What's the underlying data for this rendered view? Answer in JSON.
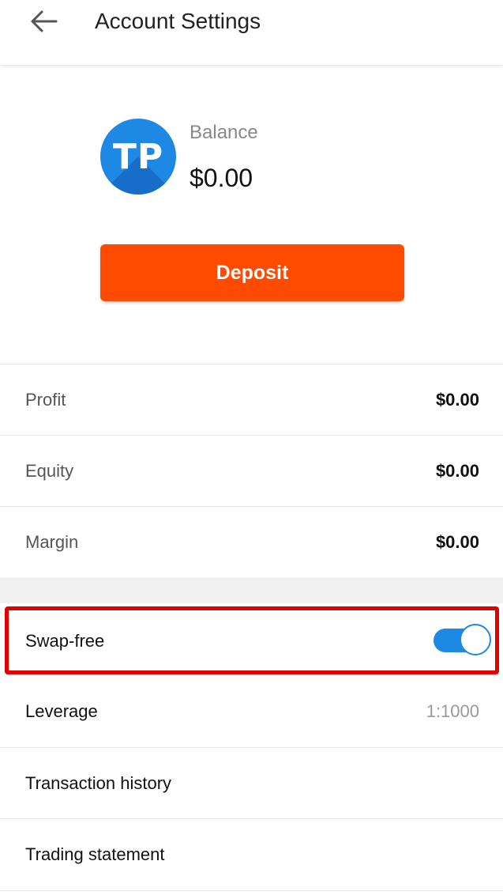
{
  "header": {
    "title": "Account Settings",
    "back_icon": "arrow-left-icon"
  },
  "account": {
    "avatar_initials": "TP",
    "balance_label": "Balance",
    "balance_value": "$0.00",
    "deposit_label": "Deposit"
  },
  "stats": [
    {
      "label": "Profit",
      "value": "$0.00"
    },
    {
      "label": "Equity",
      "value": "$0.00"
    },
    {
      "label": "Margin",
      "value": "$0.00"
    }
  ],
  "swap_free": {
    "label": "Swap-free",
    "enabled": true
  },
  "settings": [
    {
      "label": "Leverage",
      "value": "1:1000"
    },
    {
      "label": "Transaction history",
      "value": ""
    },
    {
      "label": "Trading statement",
      "value": ""
    }
  ],
  "colors": {
    "accent": "#1e88e5",
    "deposit": "#ff4b00",
    "highlight": "#e00000"
  }
}
